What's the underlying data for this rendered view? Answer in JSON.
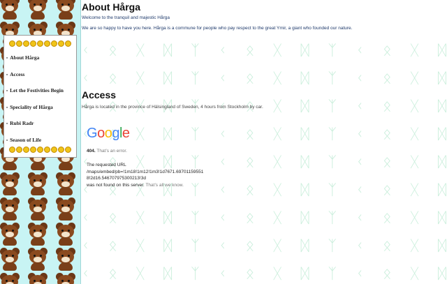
{
  "nav": {
    "items": [
      {
        "label": "About Hårga"
      },
      {
        "label": "Access"
      },
      {
        "label": "Let the Festivities Begin"
      },
      {
        "label": "Speciality of Hårga"
      },
      {
        "label": "Rubi Radr"
      },
      {
        "label": "Season of Life"
      }
    ]
  },
  "about": {
    "heading": "About Hårga",
    "welcome": "Welcome to the tranquil and majestic Hårga",
    "intro": "We are so happy to have you here. Hårga is a commune for people who pay respect to the great Ymir, a giant who founded our nature."
  },
  "access": {
    "heading": "Access",
    "location": "Hårga is located in the province of Hälsingland of Sweden, 4 hours from Stockholm by car."
  },
  "map_error": {
    "logo_letters": [
      "G",
      "o",
      "o",
      "g",
      "l",
      "e"
    ],
    "code": "404.",
    "code_text": "That’s an error.",
    "message_line1": "The requested URL",
    "url": "/maps/embed/pb=!1m18!1m12!1m3!1d7671.697011595518!2d16.546707975300213!3d",
    "message_tail": "was not found on this server.",
    "message_muted": "That’s all we know."
  },
  "background": {
    "rune_row": "ᚲ ᛟ ᚷ ᛞ ᛉ ᚲ ᛟ ᚷ ᛞ ᛉ ᚲ ᛟ ᚷ ᛞ ᛉ"
  },
  "colors": {
    "side_bg": "#c8f4f4",
    "rune_color": "#c9eedb",
    "link_text": "#1f3a6b"
  }
}
